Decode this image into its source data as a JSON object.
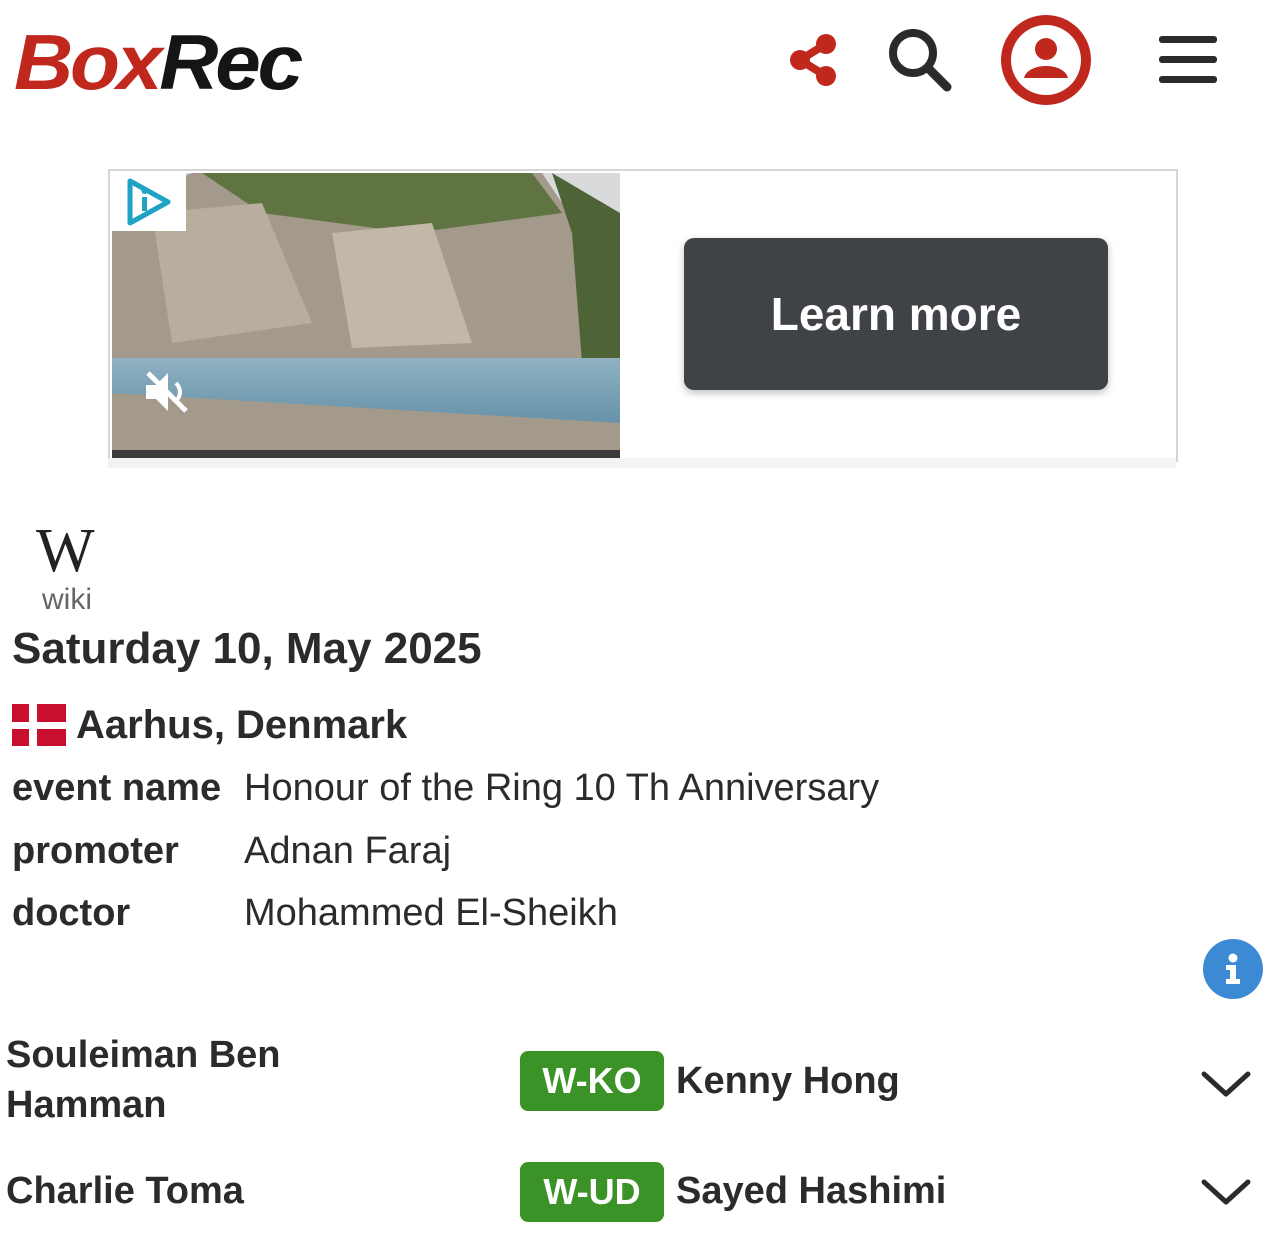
{
  "header": {
    "logo_part1": "Box",
    "logo_part2": "Rec",
    "brand_color": "#c0281e",
    "icons": [
      "share-icon",
      "search-icon",
      "user-icon",
      "menu-icon"
    ]
  },
  "ad": {
    "cta_label": "Learn more",
    "icons": [
      "adchoices-icon",
      "mute-icon"
    ]
  },
  "wiki": {
    "letter": "W",
    "label": "wiki"
  },
  "event": {
    "date": "Saturday 10, May 2025",
    "location": "Aarhus, Denmark",
    "details": [
      {
        "label": "event name",
        "value": "Honour of the Ring 10 Th Anniversary"
      },
      {
        "label": "promoter",
        "value": "Adnan Faraj"
      },
      {
        "label": "doctor",
        "value": "Mohammed El-Sheikh"
      }
    ]
  },
  "bouts": [
    {
      "fighter_a_line1": "Souleiman Ben",
      "fighter_a_line2": "Hamman",
      "result": "W-KO",
      "fighter_b": "Kenny Hong"
    },
    {
      "fighter_a_line1": "Charlie Toma",
      "fighter_a_line2": "",
      "result": "W-UD",
      "fighter_b": "Sayed Hashimi"
    }
  ],
  "colors": {
    "win_badge": "#3b9226",
    "info_button": "#3d8ad4",
    "cta_background": "#3f4246"
  }
}
